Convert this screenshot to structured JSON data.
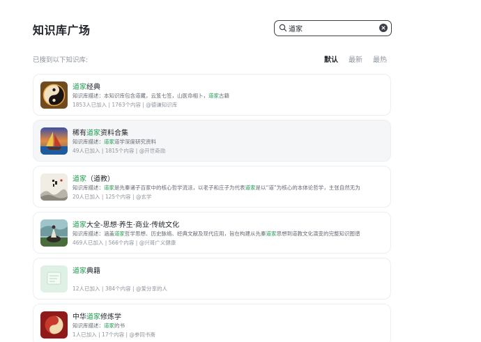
{
  "page": {
    "title": "知识库广场"
  },
  "search": {
    "value": "道家"
  },
  "results": {
    "summary": "已搜到以下知识库:"
  },
  "sort": {
    "options": [
      "默认",
      "最新",
      "最热"
    ],
    "active": "默认"
  },
  "colors": {
    "highlight": "#1f9b4f",
    "text": "#1f2329",
    "muted": "#8f959e"
  },
  "cards": [
    {
      "title": [
        {
          "t": "道家",
          "hl": true
        },
        {
          "t": "经典",
          "hl": false
        }
      ],
      "desc": [
        {
          "t": "知识库描述：本知识库包含道藏，云笈七签，山医命相卜，",
          "hl": false
        },
        {
          "t": "道家",
          "hl": true
        },
        {
          "t": "古籍",
          "hl": false
        }
      ],
      "meta": "1853人已加入 | 1763个内容 | @德谦知识库",
      "thumb": "yin-yang-icon"
    },
    {
      "title": [
        {
          "t": "稀有",
          "hl": false
        },
        {
          "t": "道家",
          "hl": true
        },
        {
          "t": "资料合集",
          "hl": false
        }
      ],
      "desc": [
        {
          "t": "知识库描述：",
          "hl": false
        },
        {
          "t": "道家",
          "hl": true
        },
        {
          "t": "道学深度研究资料",
          "hl": false
        }
      ],
      "meta": "49人已加入 | 1815个内容 | @开世奇勋",
      "thumb": "sailboat-icon"
    },
    {
      "title": [
        {
          "t": "道家",
          "hl": true
        },
        {
          "t": "（道教）",
          "hl": false
        }
      ],
      "desc": [
        {
          "t": "知识库描述：",
          "hl": false
        },
        {
          "t": "道家",
          "hl": true
        },
        {
          "t": "是先秦诸子百家中的核心哲学流派，以老子和庄子为代表",
          "hl": false
        },
        {
          "t": "道家",
          "hl": true
        },
        {
          "t": "是以“道”为核心的本体论哲学，主张自然无为",
          "hl": false
        }
      ],
      "meta": "20人已加入 | 125个内容 | @玄学",
      "thumb": "ink-painting-icon"
    },
    {
      "title": [
        {
          "t": "道家",
          "hl": true
        },
        {
          "t": "大全-思想·养生·商业·传统文化",
          "hl": false
        }
      ],
      "desc": [
        {
          "t": "知识库描述：涵盖",
          "hl": false
        },
        {
          "t": "道家",
          "hl": true
        },
        {
          "t": "哲学思想、历史脉络、经典文献及现代应用，旨在构建从先秦",
          "hl": false
        },
        {
          "t": "道家",
          "hl": true
        },
        {
          "t": "思想到道教文化演变的完整知识图谱",
          "hl": false
        }
      ],
      "meta": "469人已加入 | 566个内容 | @兴哥广义健康",
      "thumb": "sage-on-ox-icon"
    },
    {
      "title": [
        {
          "t": "道家",
          "hl": true
        },
        {
          "t": "典籍",
          "hl": false
        }
      ],
      "desc": [],
      "meta": "12人已加入 | 384个内容 | @爱分享的人",
      "thumb": "default-doc-icon"
    },
    {
      "title": [
        {
          "t": "中华",
          "hl": false
        },
        {
          "t": "道家",
          "hl": true
        },
        {
          "t": "修炼学",
          "hl": false
        }
      ],
      "desc": [
        {
          "t": "知识库描述：",
          "hl": false
        },
        {
          "t": "道家",
          "hl": true
        },
        {
          "t": "的书",
          "hl": false
        }
      ],
      "meta": "1人已加入 | 17个内容 | @参同书斋",
      "thumb": "red-taiji-icon"
    }
  ]
}
